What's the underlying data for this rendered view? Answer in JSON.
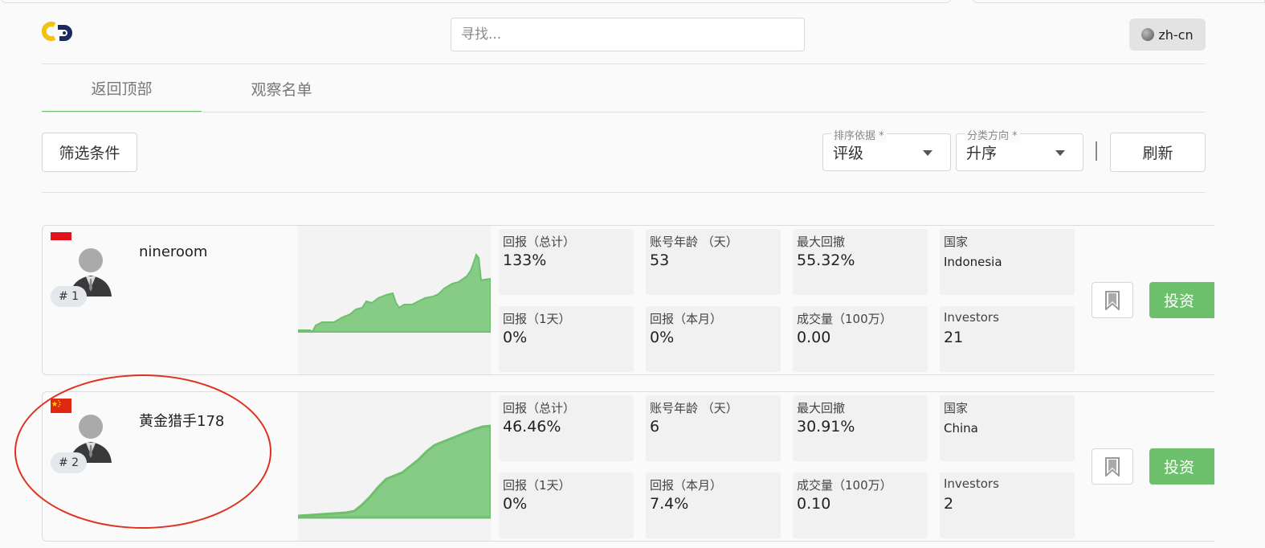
{
  "header": {
    "search_placeholder": "寻找...",
    "language": "zh-cn"
  },
  "tabs": [
    {
      "label": "返回顶部",
      "active": true
    },
    {
      "label": "观察名单",
      "active": false
    }
  ],
  "toolbar": {
    "filter_label": "筛选条件",
    "sort_by": {
      "label": "排序依据 *",
      "value": "评级"
    },
    "sort_dir": {
      "label": "分类方向 *",
      "value": "升序"
    },
    "refresh_label": "刷新"
  },
  "colors": {
    "accent": "#6cc06c",
    "highlight": "#e0301e"
  },
  "traders": [
    {
      "rank": "# 1",
      "name": "nineroom",
      "flag": "indonesia",
      "stats": {
        "total_return": {
          "label": "回报（总计）",
          "value": "133%"
        },
        "account_age": {
          "label": "账号年龄 （天）",
          "value": "53"
        },
        "max_drawdown": {
          "label": "最大回撤",
          "value": "55.32%"
        },
        "country": {
          "label": "国家",
          "value": "Indonesia"
        },
        "return_1d": {
          "label": "回报（1天）",
          "value": "0%"
        },
        "return_month": {
          "label": "回报（本月）",
          "value": "0%"
        },
        "volume": {
          "label": "成交量（100万）",
          "value": "0.00"
        },
        "investors": {
          "label": "Investors",
          "value": "21"
        }
      },
      "invest_label": "投资"
    },
    {
      "rank": "# 2",
      "name": "黄金猎手178",
      "flag": "china",
      "stats": {
        "total_return": {
          "label": "回报（总计）",
          "value": "46.46%"
        },
        "account_age": {
          "label": "账号年龄 （天）",
          "value": "6"
        },
        "max_drawdown": {
          "label": "最大回撤",
          "value": "30.91%"
        },
        "country": {
          "label": "国家",
          "value": "China"
        },
        "return_1d": {
          "label": "回报（1天）",
          "value": "0%"
        },
        "return_month": {
          "label": "回报（本月）",
          "value": "7.4%"
        },
        "volume": {
          "label": "成交量（100万）",
          "value": "0.10"
        },
        "investors": {
          "label": "Investors",
          "value": "2"
        }
      },
      "invest_label": "投资"
    }
  ]
}
